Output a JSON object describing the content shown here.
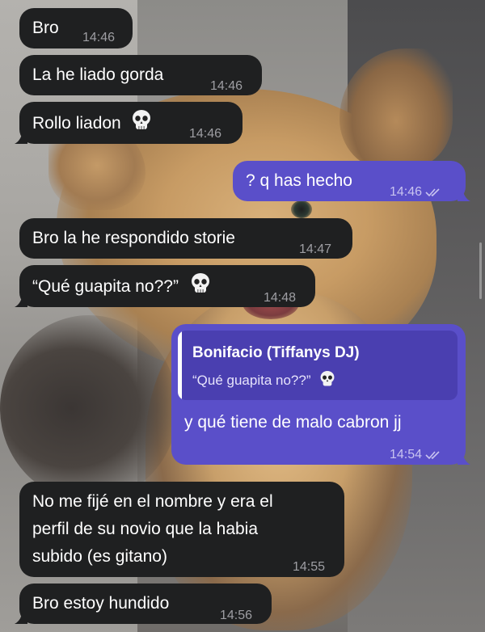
{
  "messages": [
    {
      "dir": "in",
      "text": "Bro",
      "time": "14:46"
    },
    {
      "dir": "in",
      "text": "La he liado gorda",
      "time": "14:46"
    },
    {
      "dir": "in",
      "text": "Rollo liadon",
      "emoji": "skull-icon",
      "time": "14:46"
    },
    {
      "dir": "out",
      "text": "? q has hecho",
      "time": "14:46",
      "status": "read"
    },
    {
      "dir": "in",
      "text": "Bro la he respondido storie",
      "time": "14:47"
    },
    {
      "dir": "in",
      "text": "“Qué guapita no??”",
      "emoji": "skull-icon",
      "time": "14:48"
    },
    {
      "dir": "out",
      "reply": {
        "name": "Bonifacio (Tiffanys DJ)",
        "text": "“Qué guapita no??”",
        "emoji": "skull-icon"
      },
      "text": "y qué tiene de malo cabron jj",
      "time": "14:54",
      "status": "read"
    },
    {
      "dir": "in",
      "lines": [
        "No me fijé en el nombre y era el",
        "perfil de su novio que la habia",
        "subido (es gitano)"
      ],
      "time": "14:55"
    },
    {
      "dir": "in",
      "text": "Bro estoy hundido",
      "time": "14:56"
    }
  ],
  "colors": {
    "incoming": "#1f2021",
    "outgoing": "#5a4fc9",
    "reply_block": "#4a3fb0"
  }
}
